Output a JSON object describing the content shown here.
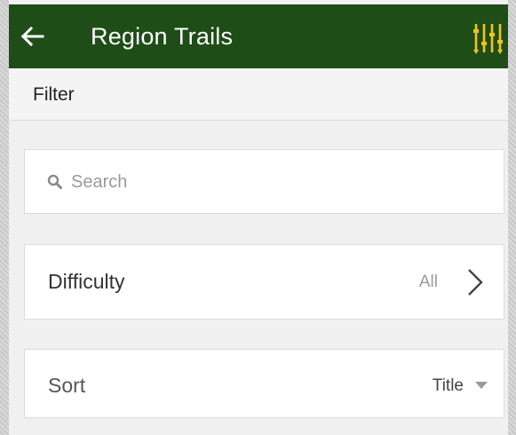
{
  "app_bar": {
    "title": "Region Trails",
    "background": "#1f4d18",
    "accent": "#f2c314",
    "back_icon": "arrow-left-icon",
    "action_icon": "sliders-filter-icon"
  },
  "subheader": {
    "title": "Filter"
  },
  "search": {
    "placeholder": "Search",
    "value": "",
    "icon": "search-icon"
  },
  "difficulty": {
    "label": "Difficulty",
    "value": "All",
    "icon": "chevron-right-icon"
  },
  "sort": {
    "label": "Sort",
    "value": "Title",
    "icon": "dropdown-arrow-icon"
  }
}
